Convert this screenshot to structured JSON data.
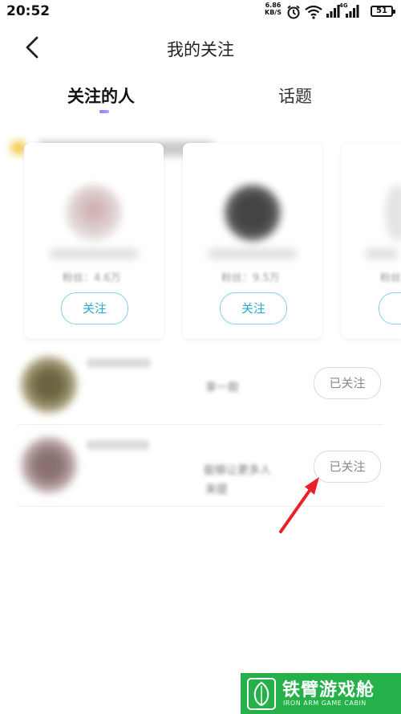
{
  "status_bar": {
    "time": "20:52",
    "net_speed_value": "6.86",
    "net_speed_unit": "KB/S",
    "network_type": "4G",
    "battery": "51"
  },
  "header": {
    "title": "我的关注"
  },
  "tabs": [
    {
      "label": "关注的人",
      "active": true
    },
    {
      "label": "话题",
      "active": false
    }
  ],
  "recommended": [
    {
      "fans": "粉丝：4.6万",
      "button": "关注"
    },
    {
      "fans": "粉丝：9.5万",
      "button": "关注"
    },
    {
      "fans": "粉丝",
      "button": ""
    }
  ],
  "following": [
    {
      "snippet": "享一款",
      "button": "已关注"
    },
    {
      "snippet": "能够让更多人",
      "snippet2": "来提",
      "button": "已关注"
    }
  ],
  "watermark": {
    "cn": "铁臂游戏舱",
    "en": "IRON ARM GAME CABIN"
  },
  "colors": {
    "accent": "#2aa6d4",
    "watermark_bg": "#25b04a",
    "arrow": "#e8202a"
  }
}
